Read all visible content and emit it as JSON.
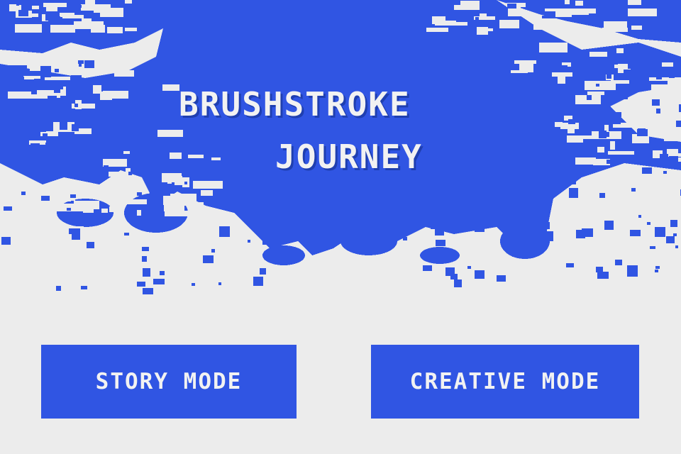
{
  "colors": {
    "background": "#ececec",
    "paint_blue": "#3055e3",
    "text_light": "#f2f2f2"
  },
  "title": {
    "line1": "BRUSHSTROKE",
    "line2": "JOURNEY"
  },
  "menu": {
    "story_mode_label": "STORY MODE",
    "creative_mode_label": "CREATIVE MODE"
  }
}
